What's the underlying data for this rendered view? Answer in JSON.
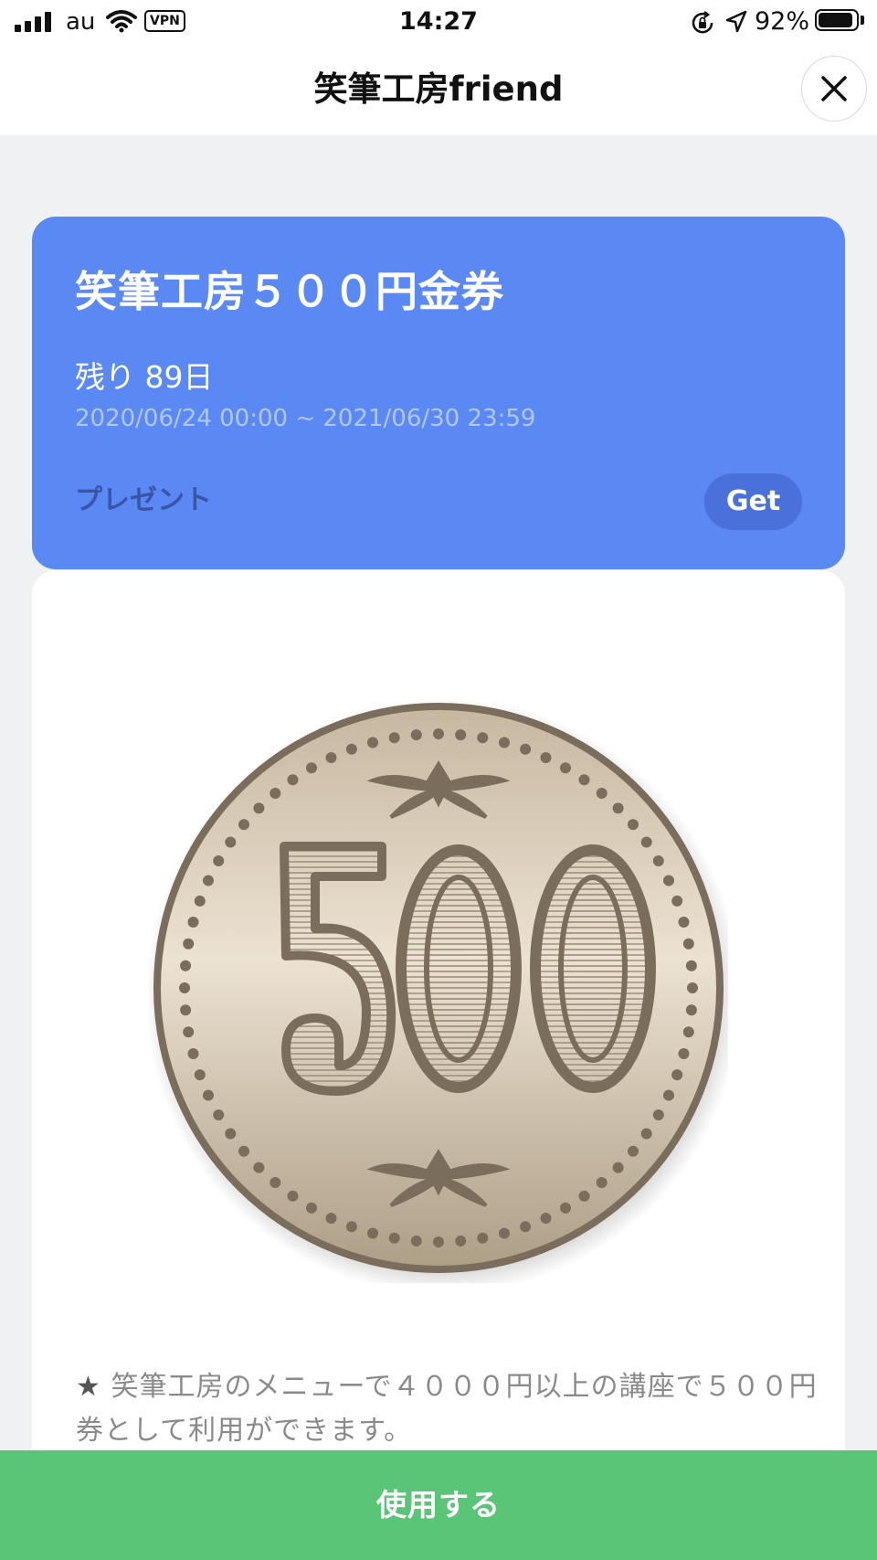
{
  "status_bar": {
    "carrier": "au",
    "vpn_label": "VPN",
    "time": "14:27",
    "battery_percent": "92%",
    "battery_level": 0.92
  },
  "header": {
    "title": "笑筆工房friend"
  },
  "coupon": {
    "title": "笑筆工房５００円金券",
    "remaining": "残り 89日",
    "period": "2020/06/24 00:00 ~ 2021/06/30 23:59",
    "type": "プレゼント",
    "get_label": "Get",
    "background_color": "#5b89f4"
  },
  "coin": {
    "denomination": "500"
  },
  "description": {
    "star": "★",
    "text": " 笑筆工房のメニューで４０００円以上の講座で５００円券として利用ができます。"
  },
  "use_button": {
    "label": "使用する",
    "color": "#5bc577"
  }
}
